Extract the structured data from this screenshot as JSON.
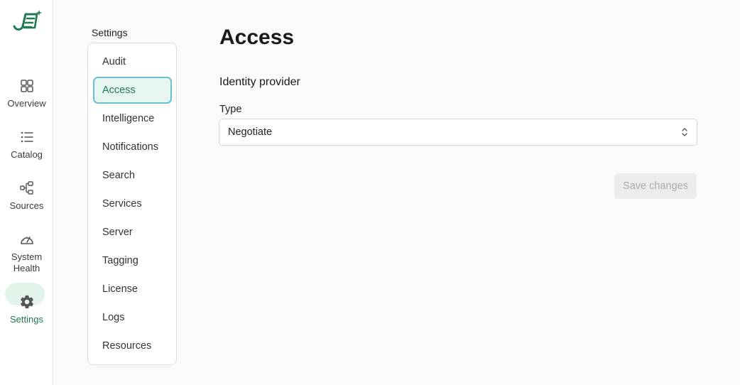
{
  "rail": {
    "items": [
      {
        "label": "Overview",
        "icon": "grid-icon"
      },
      {
        "label": "Catalog",
        "icon": "list-icon"
      },
      {
        "label": "Sources",
        "icon": "network-icon"
      },
      {
        "label": "System Health",
        "icon": "gauge-icon"
      },
      {
        "label": "Settings",
        "icon": "gear-icon",
        "active": true
      }
    ]
  },
  "settings": {
    "title": "Settings",
    "menu": [
      {
        "label": "Audit"
      },
      {
        "label": "Access",
        "active": true
      },
      {
        "label": "Intelligence"
      },
      {
        "label": "Notifications"
      },
      {
        "label": "Search"
      },
      {
        "label": "Services"
      },
      {
        "label": "Server"
      },
      {
        "label": "Tagging"
      },
      {
        "label": "License"
      },
      {
        "label": "Logs"
      },
      {
        "label": "Resources"
      }
    ]
  },
  "main": {
    "title": "Access",
    "section_title": "Identity provider",
    "type_label": "Type",
    "type_value": "Negotiate",
    "save_label": "Save changes"
  },
  "colors": {
    "brand": "#1e7a52",
    "active_bg": "#e3f4ea",
    "focus_border": "#6cbfd0"
  }
}
